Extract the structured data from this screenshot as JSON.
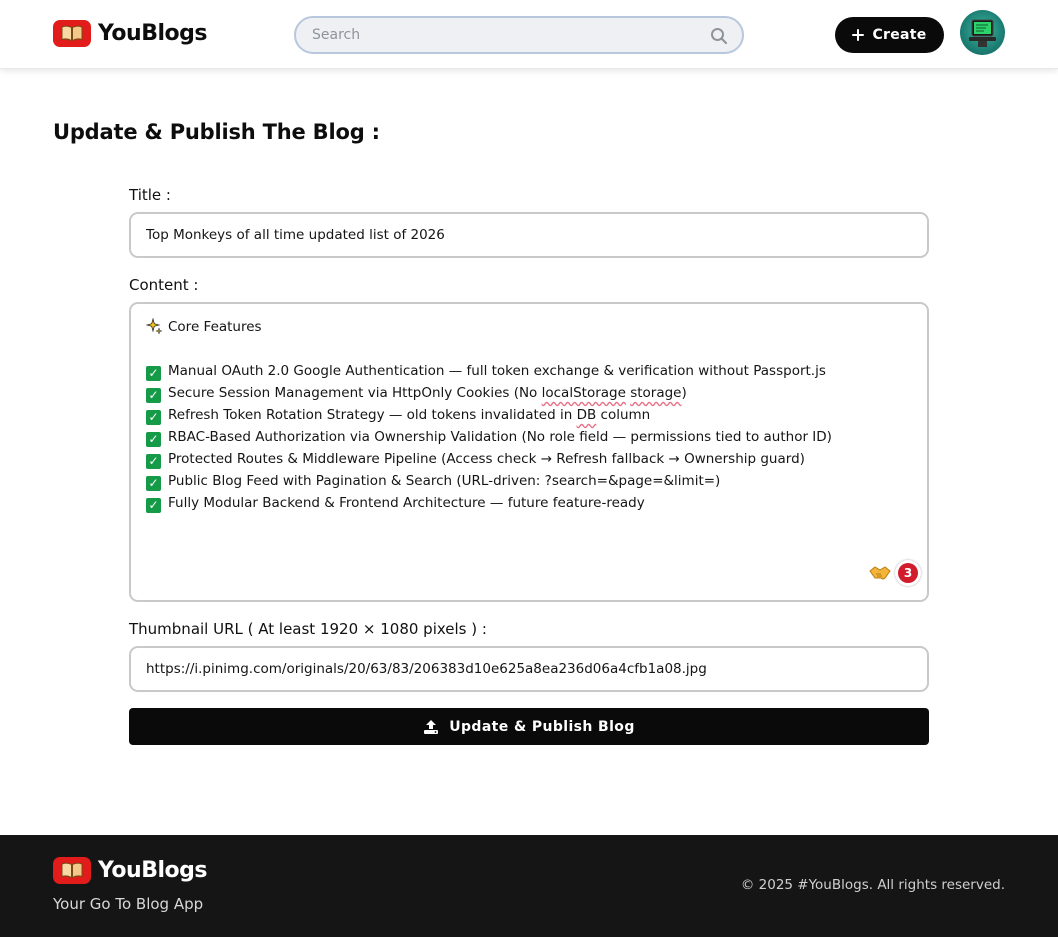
{
  "header": {
    "brand_name": "YouBlogs",
    "search_placeholder": "Search",
    "create_label": "Create"
  },
  "main": {
    "page_title": "Update & Publish The Blog :",
    "title_label": "Title :",
    "title_value": "Top Monkeys of all time updated list of 2026",
    "content_label": "Content :",
    "content": {
      "heading": "Core Features",
      "items": [
        "Manual OAuth 2.0 Google Authentication — full token exchange & verification without Passport.js",
        "Secure Session Management via HttpOnly Cookies (No ",
        "Refresh Token Rotation Strategy — old tokens invalidated in ",
        "RBAC-Based Authorization via Ownership Validation (No role field — permissions tied to author ID)",
        "Protected Routes & Middleware Pipeline (Access check → Refresh fallback → Ownership guard)",
        "Public Blog Feed with Pagination & Search (URL-driven: ?search=&page=&limit=)",
        "Fully Modular Backend & Frontend Architecture — future feature-ready"
      ],
      "item2_word1": "localStorage",
      "item2_word2": "storage",
      "item2_tail": ")",
      "item3_word": "DB",
      "item3_tail": " column"
    },
    "extension_badge_count": "3",
    "thumbnail_label": "Thumbnail URL ( At least 1920 × 1080 pixels ) :",
    "thumbnail_value": "https://i.pinimg.com/originals/20/63/83/206383d10e625a8ea236d06a4cfb1a08.jpg",
    "publish_label": "Update & Publish Blog"
  },
  "footer": {
    "brand_name": "YouBlogs",
    "tagline": "Your Go To Blog App",
    "copyright": "© 2025 #YouBlogs. All rights reserved."
  },
  "colors": {
    "brand_red": "#e21b1b",
    "dark": "#0a0a0a",
    "footer_bg": "#151515",
    "check_green": "#159a47"
  },
  "icons": [
    "book-logo-icon",
    "search-icon",
    "plus-icon",
    "avatar",
    "sparkles-icon",
    "check-icon",
    "handshake-icon",
    "upload-icon"
  ]
}
